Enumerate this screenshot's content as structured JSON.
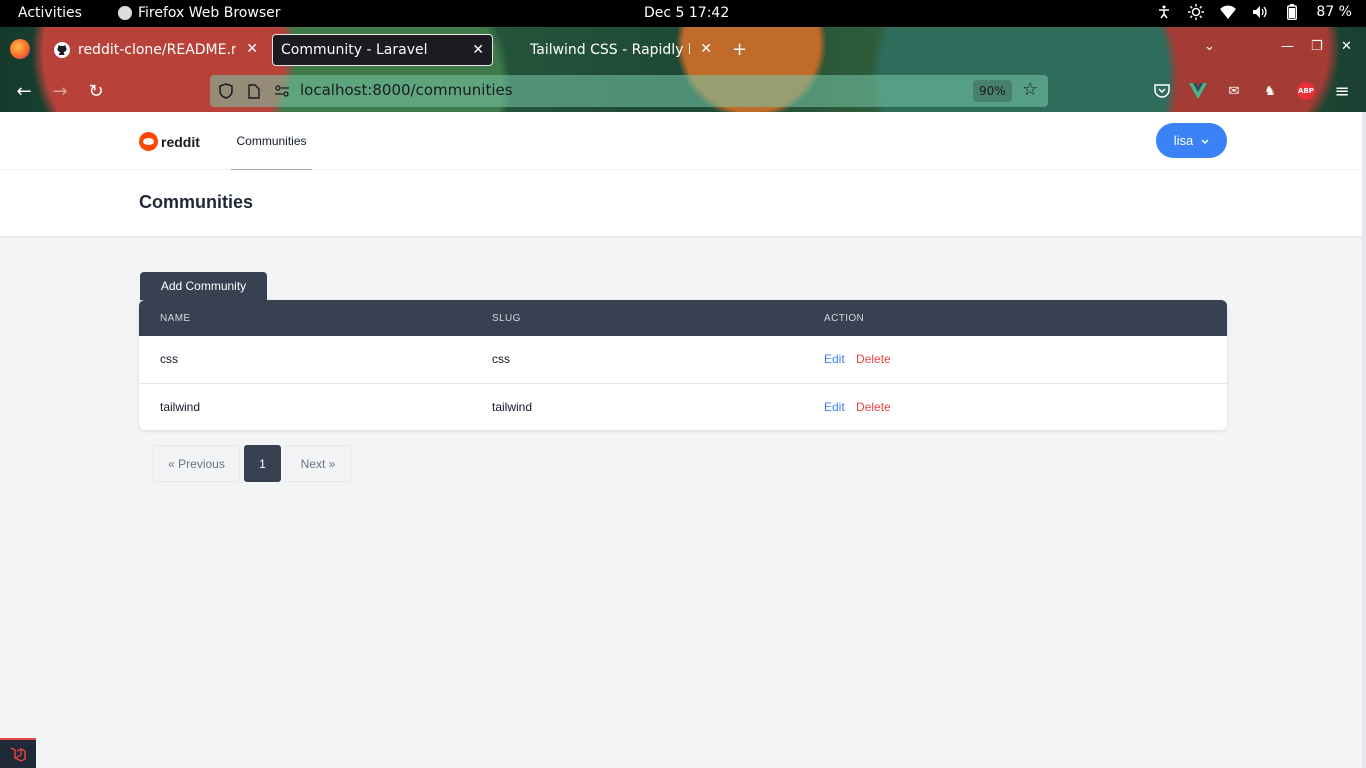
{
  "system_bar": {
    "activities": "Activities",
    "app_name": "Firefox Web Browser",
    "clock": "Dec 5  17:42",
    "battery": "87 %"
  },
  "browser": {
    "tabs": [
      {
        "title": "reddit-clone/README.md",
        "icon": "github-icon"
      },
      {
        "title": "Community - Laravel",
        "icon": "page-icon",
        "active": true
      },
      {
        "title": "Tailwind CSS - Rapidly b",
        "icon": "tailwind-icon"
      }
    ],
    "url": "localhost:8000/communities",
    "zoom": "90%"
  },
  "app": {
    "logo_text": "reddit",
    "nav_link": "Communities",
    "user_button": "lisa",
    "page_title": "Communities",
    "add_button": "Add Community",
    "table": {
      "headers": [
        "NAME",
        "SLUG",
        "ACTION"
      ],
      "rows": [
        {
          "name": "css",
          "slug": "css",
          "edit": "Edit",
          "delete": "Delete"
        },
        {
          "name": "tailwind",
          "slug": "tailwind",
          "edit": "Edit",
          "delete": "Delete"
        }
      ]
    },
    "pagination": {
      "previous": "« Previous",
      "current": "1",
      "next": "Next »"
    }
  },
  "colors": {
    "accent_blue": "#3b82f6",
    "dark_header": "#374151",
    "danger_red": "#ef4444",
    "reddit_orange": "#ff4500"
  }
}
